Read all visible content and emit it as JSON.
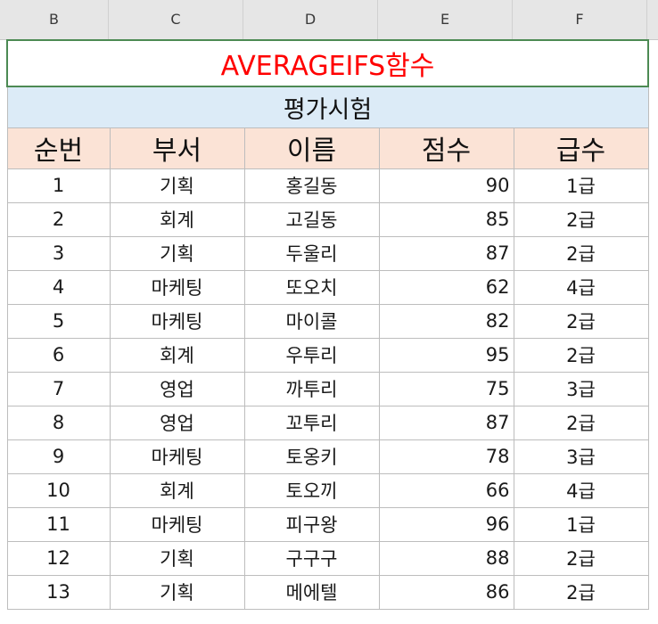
{
  "column_headers": [
    "B",
    "C",
    "D",
    "E",
    "F"
  ],
  "sheet": {
    "title": "AVERAGEIFS함수",
    "subtitle": "평가시험",
    "headers": [
      "순번",
      "부서",
      "이름",
      "점수",
      "급수"
    ],
    "rows": [
      [
        "1",
        "기획",
        "홍길동",
        "90",
        "1급"
      ],
      [
        "2",
        "회계",
        "고길동",
        "85",
        "2급"
      ],
      [
        "3",
        "기획",
        "두울리",
        "87",
        "2급"
      ],
      [
        "4",
        "마케팅",
        "또오치",
        "62",
        "4급"
      ],
      [
        "5",
        "마케팅",
        "마이콜",
        "82",
        "2급"
      ],
      [
        "6",
        "회계",
        "우투리",
        "95",
        "2급"
      ],
      [
        "7",
        "영업",
        "까투리",
        "75",
        "3급"
      ],
      [
        "8",
        "영업",
        "꼬투리",
        "87",
        "2급"
      ],
      [
        "9",
        "마케팅",
        "토옹키",
        "78",
        "3급"
      ],
      [
        "10",
        "회계",
        "토오끼",
        "66",
        "4급"
      ],
      [
        "11",
        "마케팅",
        "피구왕",
        "96",
        "1급"
      ],
      [
        "12",
        "기획",
        "구구구",
        "88",
        "2급"
      ],
      [
        "13",
        "기획",
        "메에텔",
        "86",
        "2급"
      ]
    ]
  },
  "colors": {
    "title_text": "#ff0000",
    "subtitle_fill": "#dcebf7",
    "header_fill": "#fbe3d6",
    "selection_border": "#4c8a53"
  }
}
